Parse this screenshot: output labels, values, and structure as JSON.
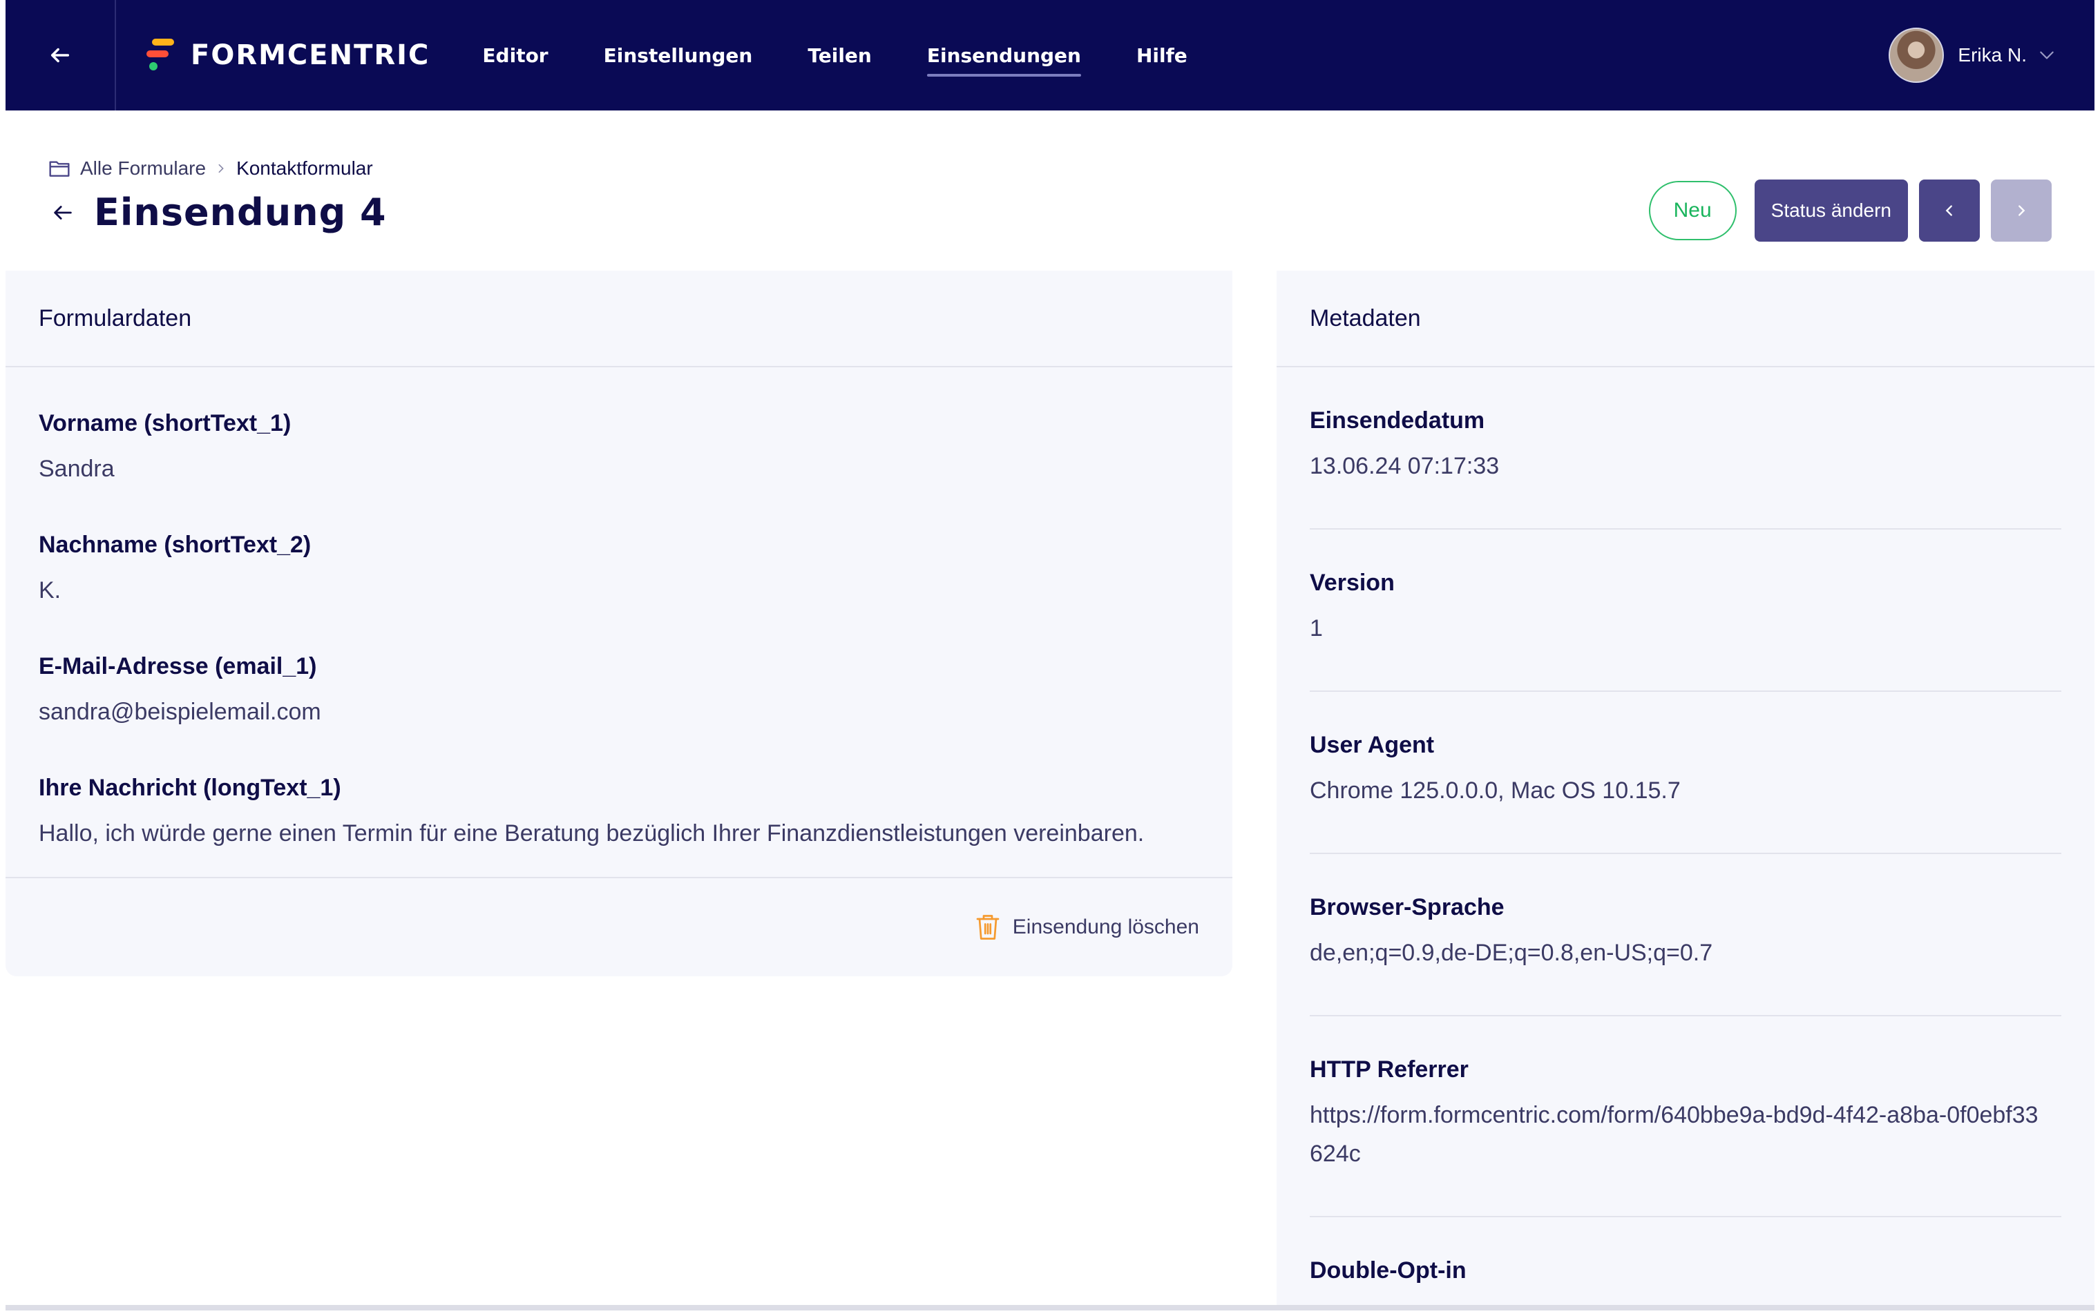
{
  "topbar": {
    "brand": "FORMCENTRIC",
    "nav": [
      "Editor",
      "Einstellungen",
      "Teilen",
      "Einsendungen",
      "Hilfe"
    ],
    "active_nav": "Einsendungen",
    "user_name": "Erika N."
  },
  "breadcrumb": {
    "root": "Alle Formulare",
    "current": "Kontaktformular"
  },
  "page": {
    "title": "Einsendung 4"
  },
  "actions": {
    "status_badge": "Neu",
    "change_status": "Status ändern"
  },
  "form_panel": {
    "title": "Formulardaten",
    "fields": [
      {
        "label": "Vorname (shortText_1)",
        "value": "Sandra"
      },
      {
        "label": "Nachname (shortText_2)",
        "value": "K."
      },
      {
        "label": "E-Mail-Adresse (email_1)",
        "value": "sandra@beispielemail.com"
      },
      {
        "label": "Ihre Nachricht (longText_1)",
        "value": "Hallo, ich würde gerne einen Termin für eine Beratung bezüglich Ihrer Finanzdienstleistungen vereinbaren."
      }
    ],
    "delete_label": "Einsendung löschen"
  },
  "meta_panel": {
    "title": "Metadaten",
    "fields": [
      {
        "label": "Einsendedatum",
        "value": "13.06.24 07:17:33"
      },
      {
        "label": "Version",
        "value": "1"
      },
      {
        "label": "User Agent",
        "value": "Chrome 125.0.0.0, Mac OS 10.15.7"
      },
      {
        "label": "Browser-Sprache",
        "value": "de,en;q=0.9,de-DE;q=0.8,en-US;q=0.7"
      },
      {
        "label": "HTTP Referrer",
        "value": "https://form.formcentric.com/form/640bbe9a-bd9d-4f42-a8ba-0f0ebf33624c"
      },
      {
        "label": "Double-Opt-in",
        "value": ""
      }
    ]
  },
  "colors": {
    "nav_bg": "#0a0a55",
    "primary": "#4a4588",
    "status_green": "#2fbf6c",
    "delete_orange": "#f59a2f",
    "panel_bg": "#f6f7fc"
  },
  "icons": {
    "topbar_back": "arrow-left-icon",
    "logo": "formcentric-logo-icon",
    "user_menu": "chevron-down-icon",
    "breadcrumb_root": "folder-icon",
    "breadcrumb_separator": "chevron-right-icon",
    "title_back": "arrow-left-icon",
    "prev": "chevron-left-icon",
    "next": "chevron-right-icon",
    "delete": "trash-icon"
  }
}
